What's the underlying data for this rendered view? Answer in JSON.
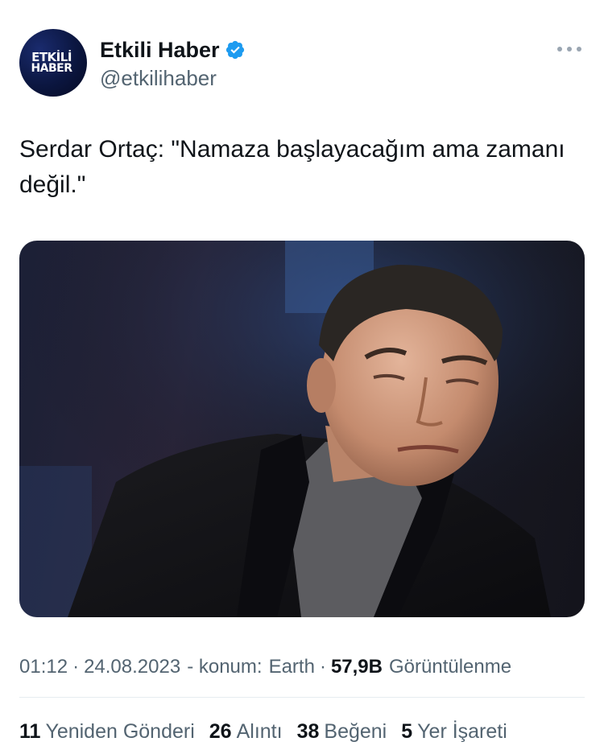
{
  "account": {
    "avatar_text_line1": "ETKİLİ",
    "avatar_text_line2": "HABER",
    "display_name": "Etkili Haber",
    "handle": "@etkilihaber",
    "verified_icon": "verified-badge-icon",
    "verified_color": "#1d9bf0"
  },
  "tweet": {
    "text": "Serdar Ortaç: \"Namaza başlayacağım ama zamanı değil.\"",
    "image_description": "photo-of-man-in-black-jacket"
  },
  "meta": {
    "time": "01:12",
    "dot1": "·",
    "date": "24.08.2023",
    "location_prefix": "- konum:",
    "location": "Earth",
    "dot2": "·",
    "views_count": "57,9B",
    "views_label": "Görüntülenme"
  },
  "stats": [
    {
      "count": "11",
      "label": "Yeniden Gönderi"
    },
    {
      "count": "26",
      "label": "Alıntı"
    },
    {
      "count": "38",
      "label": "Beğeni"
    },
    {
      "count": "5",
      "label": "Yer İşareti"
    }
  ],
  "colors": {
    "text_primary": "#0f1419",
    "text_secondary": "#536471",
    "divider": "#e6ecf0"
  }
}
